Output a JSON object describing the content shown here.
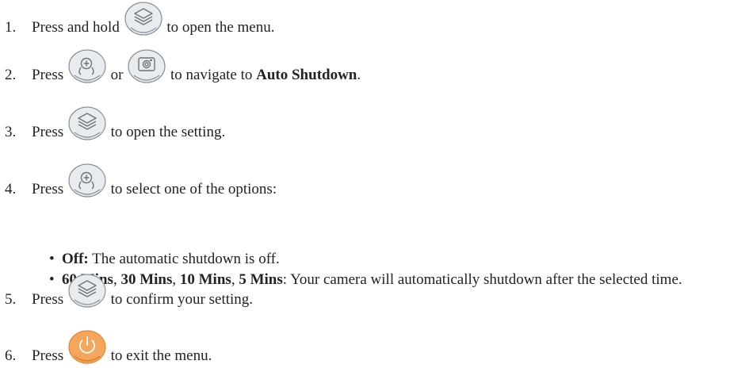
{
  "steps": [
    {
      "num": "1.",
      "before": "Press and hold",
      "after": "to open the menu."
    },
    {
      "num": "2.",
      "before": "Press",
      "middle": "or",
      "after": "to navigate to",
      "bold": "Auto Shutdown",
      "end": "."
    },
    {
      "num": "3.",
      "before": "Press",
      "after": "to open the setting."
    },
    {
      "num": "4.",
      "before": "Press",
      "after": "to select one of the options:"
    },
    {
      "num": "5.",
      "before": "Press",
      "after": "to confirm your setting."
    },
    {
      "num": "6.",
      "before": "Press",
      "after": "to exit the menu."
    }
  ],
  "bullets": [
    {
      "bullet": "•",
      "bold": "Off:",
      "text": " The automatic shutdown is off."
    },
    {
      "bullet": "•",
      "bold1": "60 Mins",
      "sep1": ", ",
      "bold2": "30 Mins",
      "sep2": ", ",
      "bold3": "10 Mins",
      "sep3": ", ",
      "bold4": "5 Mins",
      "text": ": Your camera will automatically shutdown after the selected time."
    }
  ],
  "icons": {
    "menu": "layers-menu-icon",
    "zoom": "zoom-icon",
    "camera": "camera-icon",
    "power": "power-icon"
  },
  "colors": {
    "button_fill": "#e9ecef",
    "button_stroke": "#8a9097",
    "glyph": "#6d737a",
    "power_fill": "#f3a65c",
    "power_stroke": "#e08a33"
  }
}
